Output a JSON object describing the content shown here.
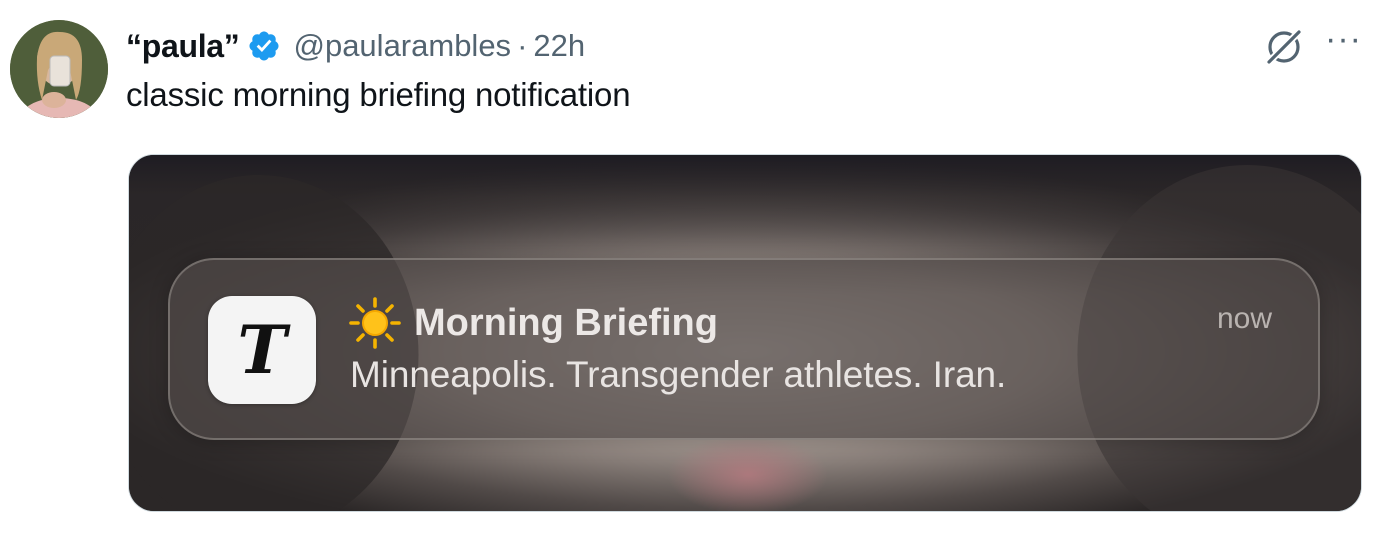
{
  "tweet": {
    "display_name": "“paula”",
    "handle": "@paularambles",
    "separator": "·",
    "time": "22h",
    "text": "classic morning briefing notification"
  },
  "icons": {
    "verified": "verified-badge-icon",
    "grok": "grok-icon",
    "more": "more-icon",
    "sun": "sun-icon",
    "app": "nyt-app-icon"
  },
  "colors": {
    "verified_blue": "#1d9bf0",
    "secondary_text": "#536471"
  },
  "notification": {
    "app_glyph": "T",
    "title": "Morning Briefing",
    "body": "Minneapolis. Transgender athletes. Iran.",
    "time": "now"
  },
  "more_label": "···"
}
